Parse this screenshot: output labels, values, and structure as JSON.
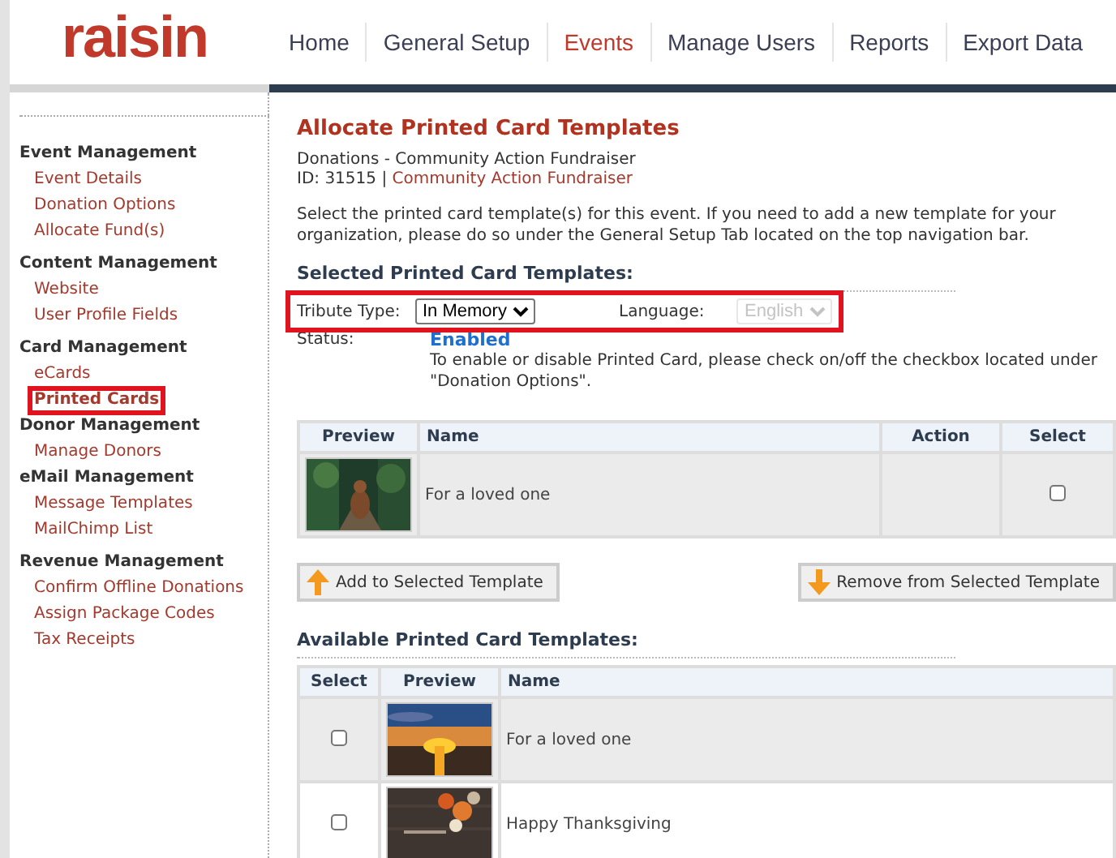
{
  "logo": {
    "text": "raisin"
  },
  "nav": [
    {
      "label": "Home",
      "selected": false
    },
    {
      "label": "General Setup",
      "selected": false
    },
    {
      "label": "Events",
      "selected": true
    },
    {
      "label": "Manage Users",
      "selected": false
    },
    {
      "label": "Reports",
      "selected": false
    },
    {
      "label": "Export Data",
      "selected": false
    }
  ],
  "sidebar": {
    "sections": [
      {
        "title": "Event Management",
        "items": [
          {
            "label": "Event Details",
            "selected": false,
            "highlighted": false
          },
          {
            "label": "Donation Options",
            "selected": false,
            "highlighted": false
          },
          {
            "label": "Allocate Fund(s)",
            "selected": false,
            "highlighted": false
          }
        ]
      },
      {
        "title": "Content Management",
        "items": [
          {
            "label": "Website",
            "selected": false,
            "highlighted": false
          },
          {
            "label": "User Profile Fields",
            "selected": false,
            "highlighted": false
          }
        ]
      },
      {
        "title": "Card Management",
        "items": [
          {
            "label": "eCards",
            "selected": false,
            "highlighted": false
          },
          {
            "label": "Printed Cards",
            "selected": true,
            "highlighted": true
          }
        ]
      },
      {
        "title": "Donor Management",
        "items": [
          {
            "label": "Manage Donors",
            "selected": false,
            "highlighted": false
          }
        ]
      },
      {
        "title": "eMail Management",
        "items": [
          {
            "label": "Message Templates",
            "selected": false,
            "highlighted": false
          },
          {
            "label": "MailChimp List",
            "selected": false,
            "highlighted": false
          }
        ]
      },
      {
        "title": "Revenue Management",
        "items": [
          {
            "label": "Confirm Offline Donations",
            "selected": false,
            "highlighted": false
          },
          {
            "label": "Assign Package Codes",
            "selected": false,
            "highlighted": false
          },
          {
            "label": "Tax Receipts",
            "selected": false,
            "highlighted": false
          }
        ]
      }
    ]
  },
  "page": {
    "title": "Allocate Printed Card Templates",
    "subtitle": "Donations - Community Action Fundraiser",
    "id_label": "ID: 31515 |",
    "event_link": "Community Action Fundraiser",
    "description": "Select the printed card template(s) for this event. If you need to add a new template for your organization, please do so under the General Setup Tab located on the top navigation bar."
  },
  "selected_section": {
    "heading": "Selected Printed Card Templates:",
    "filters": {
      "highlighted": true,
      "tribute_label": "Tribute Type:",
      "tribute_value": "In Memory",
      "language_label": "Language:",
      "language_value": "English",
      "language_disabled": true
    },
    "status_label": "Status:",
    "status_value": "Enabled",
    "status_note": "To enable or disable Printed Card, please check on/off the checkbox located under \"Donation Options\".",
    "table": {
      "columns": [
        "Preview",
        "Name",
        "Action",
        "Select"
      ],
      "rows": [
        {
          "name": "For a loved one",
          "checked": false
        }
      ]
    }
  },
  "buttons": [
    {
      "kind": "add",
      "label": "Add to Selected Template"
    },
    {
      "kind": "remove",
      "label": "Remove from Selected Template"
    }
  ],
  "available_section": {
    "heading": "Available Printed Card Templates:",
    "table": {
      "columns": [
        "Select",
        "Preview",
        "Name"
      ],
      "rows": [
        {
          "name": "For a loved one",
          "checked": false
        },
        {
          "name": "Happy Thanksgiving",
          "checked": false
        }
      ]
    }
  }
}
